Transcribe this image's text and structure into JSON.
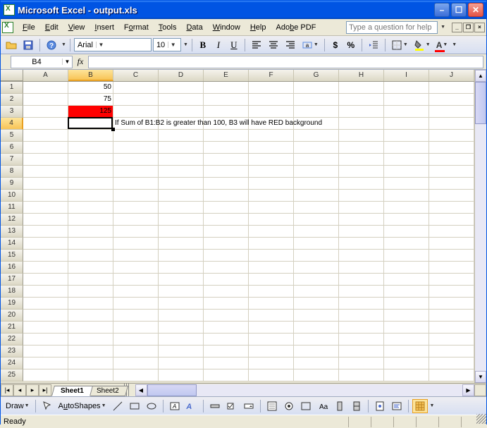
{
  "title": "Microsoft Excel - output.xls",
  "menus": {
    "file": "File",
    "edit": "Edit",
    "view": "View",
    "insert": "Insert",
    "format": "Format",
    "tools": "Tools",
    "data": "Data",
    "window": "Window",
    "help": "Help",
    "adobe": "Adobe PDF"
  },
  "help_placeholder": "Type a question for help",
  "font": {
    "name": "Arial",
    "size": "10"
  },
  "namebox": "B4",
  "status": "Ready",
  "draw_label": "Draw",
  "autoshapes_label": "AutoShapes",
  "sheets": {
    "s1": "Sheet1",
    "s2": "Sheet2"
  },
  "columns": [
    "A",
    "B",
    "C",
    "D",
    "E",
    "F",
    "G",
    "H",
    "I",
    "J"
  ],
  "rows_count": 25,
  "cells": {
    "B1": {
      "v": "50",
      "align": "right"
    },
    "B2": {
      "v": "75",
      "align": "right"
    },
    "B3": {
      "v": "125",
      "align": "right",
      "bg": "red"
    },
    "C4": {
      "v": "If Sum of B1:B2 is greater than 100, B3 will have RED background",
      "align": "left",
      "overflow": true
    }
  },
  "active_cell": "B4",
  "chart_data": null
}
